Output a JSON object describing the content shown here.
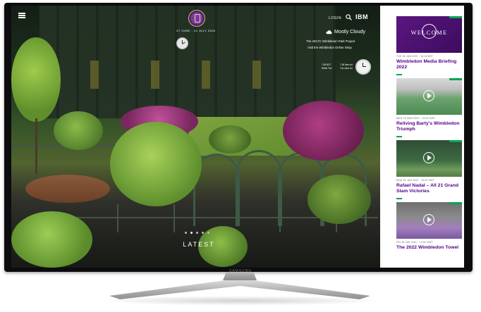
{
  "tv": {
    "brand": "SAMSUNG"
  },
  "header": {
    "dates": "27 JUNE - 10 JULY 2022",
    "login_label": "LOGIN",
    "sponsor": "IBM"
  },
  "weather": {
    "label": "Mostly Cloudy"
  },
  "links": [
    {
      "label": "The AELTC Wimbledon Park Project"
    },
    {
      "label": "Visit the Wimbledon Online Shop"
    }
  ],
  "timezones": {
    "left": [
      "7:08 BST",
      "Wimb Tue"
    ],
    "right": [
      "7:38 New for",
      "Tue clear for"
    ]
  },
  "hero": {
    "section_label": "LATEST"
  },
  "sidebar": {
    "cards": [
      {
        "thumb_text": "WELCOME",
        "date": "TUE 28 JUN 2022 · 10:15 BST",
        "title": "Wimbledon Media Briefing 2022"
      },
      {
        "date": "WED 23 MAR 2022 · 13:00 GMT",
        "title": "Reliving Barty's Wimbledon Triumph"
      },
      {
        "date": "MON 31 JAN 2022 · 15:00 GMT",
        "title": "Rafael Nadal – All 21 Grand Slam Victories"
      },
      {
        "date": "FRI 28 JAN 2022 · 12:00 GMT",
        "title": "The 2022 Wimbledon Towel"
      }
    ]
  },
  "colors": {
    "accent": "#54008b",
    "green": "#00a651"
  }
}
